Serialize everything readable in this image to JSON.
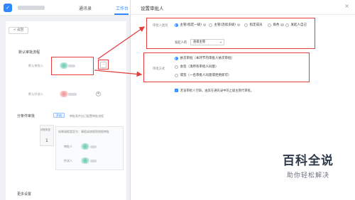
{
  "topbar": {
    "logo_glyph": "✓",
    "tabs": [
      "通讯录",
      "工作台"
    ]
  },
  "left": {
    "back_label": "< 返回",
    "section_default_flow": "默认审批流程",
    "approver_label": "默认审批人",
    "cc_label": "默认抄送人",
    "branch_label": "分条件审批",
    "branch_tag": "开启",
    "branch_hint": "审批条件自己配置审批流程",
    "cond_label": "如果请假类型为：事假或病假则按照审批",
    "approver_short": "审批人",
    "cc_short": "抄送人",
    "node_label": "请假类型",
    "more_settings": "更多设置"
  },
  "panel": {
    "title": "设置审批人",
    "close_glyph": "×",
    "approver_group_label": "审批人类别",
    "approver_options": [
      {
        "label": "主管(指定一级)",
        "selected": true
      },
      {
        "label": "主管(连续多级)",
        "selected": false
      },
      {
        "label": "指定成员",
        "selected": false
      },
      {
        "label": "角色",
        "selected": false
      },
      {
        "label": "发起人自己",
        "selected": false
      }
    ],
    "initiator_label": "发起人的",
    "initiator_select": "直接主管",
    "mode_group_label": "审批方式",
    "mode_options": [
      {
        "label": "依次审批（本环节内审批人依次审批）",
        "selected": true
      },
      {
        "label": "会签（须所有审批人同意）",
        "selected": false
      },
      {
        "label": "或签（一名审批人同意或拒绝即可）",
        "selected": false
      }
    ],
    "check_label": "若该审批人空缺，由其在通讯录中的上级主管代审批。",
    "check_glyph": "✓"
  },
  "watermark": {
    "title": "百科全说",
    "subtitle": "助你轻松解决"
  },
  "colors": {
    "accent": "#2f88ff",
    "highlight": "#e43d3d"
  }
}
